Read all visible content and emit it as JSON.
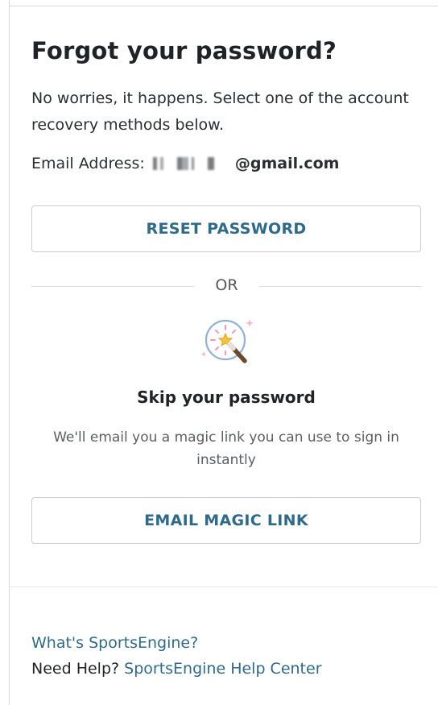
{
  "header": {
    "title": "Forgot your password?",
    "intro": "No worries, it happens. Select one of the account recovery methods below.",
    "email_label": "Email Address:",
    "email_domain": "@gmail.com"
  },
  "actions": {
    "reset_label": "RESET PASSWORD",
    "divider_text": "OR",
    "magic_label": "EMAIL MAGIC LINK"
  },
  "magic": {
    "icon": "magic-wand-icon",
    "title": "Skip your password",
    "description": "We'll email you a magic link you can use to sign in instantly"
  },
  "footer": {
    "about_link": "What's SportsEngine?",
    "help_prefix": "Need Help?",
    "help_link": "SportsEngine Help Center"
  },
  "colors": {
    "link": "#2d6a8c",
    "text": "#1f2326",
    "border": "#c9ced2"
  }
}
